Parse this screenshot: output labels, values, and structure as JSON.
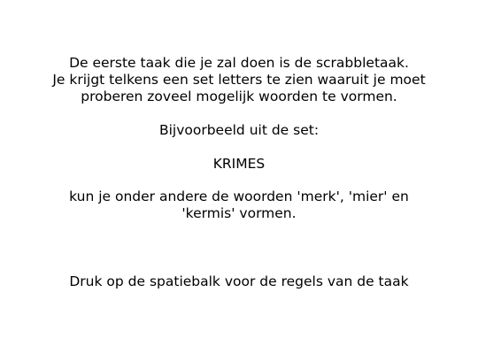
{
  "instructions": {
    "intro_lines": [
      "De eerste taak die je zal doen is de scrabbletaak.",
      "Je krijgt telkens een set letters te zien waaruit je moet",
      "proberen zoveel mogelijk woorden te vormen."
    ],
    "example_heading": "Bijvoorbeeld uit de set:",
    "example_letters": "KRIMES",
    "explanation_lines": [
      "kun je onder andere de woorden 'merk', 'mier' en",
      "'kermis' vormen."
    ],
    "continue_prompt": "Druk op de spatiebalk voor de regels van de taak"
  }
}
